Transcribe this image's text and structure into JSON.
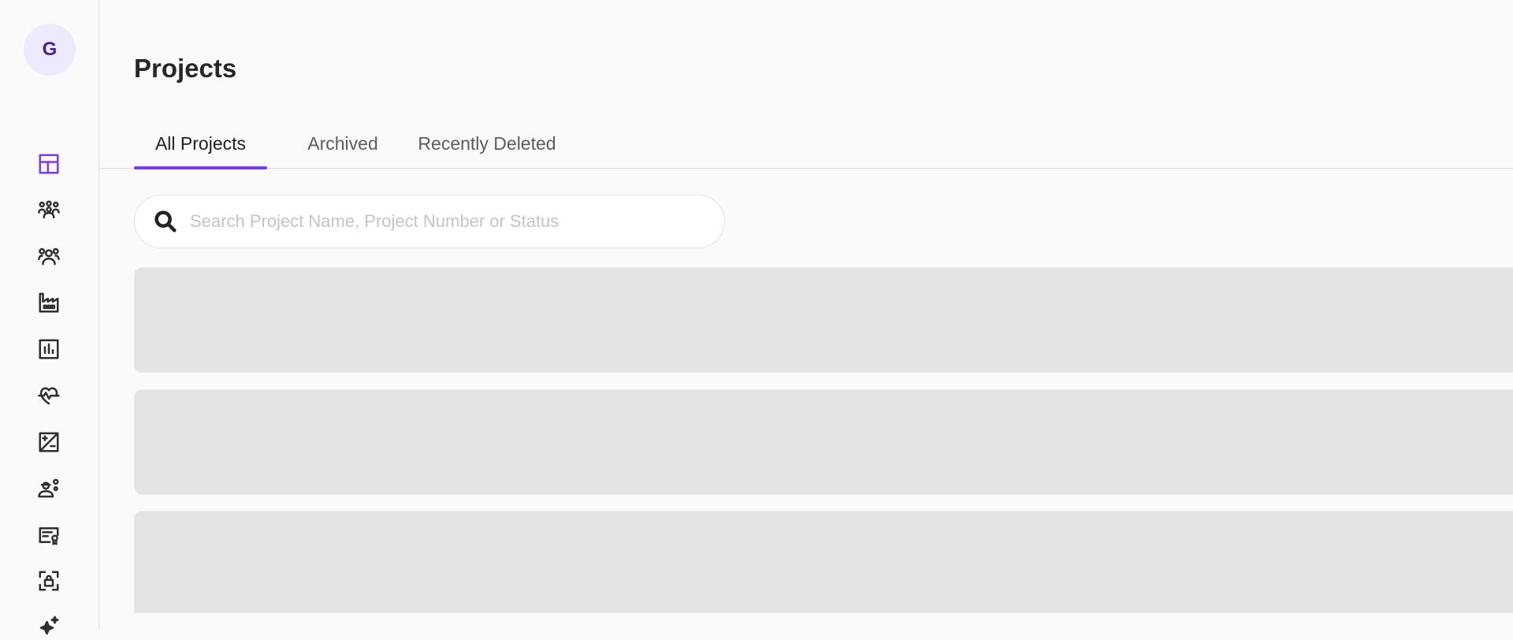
{
  "user": {
    "avatar_initial": "G"
  },
  "sidebar": {
    "items": [
      {
        "icon": "dashboard-icon",
        "active": true
      },
      {
        "icon": "team-icon",
        "active": false
      },
      {
        "icon": "people-icon",
        "active": false
      },
      {
        "icon": "factory-icon",
        "active": false
      },
      {
        "icon": "bar-chart-icon",
        "active": false
      },
      {
        "icon": "health-icon",
        "active": false
      },
      {
        "icon": "calculator-icon",
        "active": false
      },
      {
        "icon": "worker-gear-icon",
        "active": false
      },
      {
        "icon": "certificate-icon",
        "active": false
      },
      {
        "icon": "security-lock-icon",
        "active": false
      },
      {
        "icon": "sparkle-icon",
        "active": false
      }
    ]
  },
  "page": {
    "title": "Projects"
  },
  "tabs": [
    {
      "label": "All Projects",
      "active": true
    },
    {
      "label": "Archived",
      "active": false
    },
    {
      "label": "Recently Deleted",
      "active": false
    }
  ],
  "search": {
    "placeholder": "Search Project Name, Project Number or Status",
    "value": ""
  },
  "colors": {
    "accent": "#7c3aed",
    "skeleton": "#e4e4e5"
  }
}
